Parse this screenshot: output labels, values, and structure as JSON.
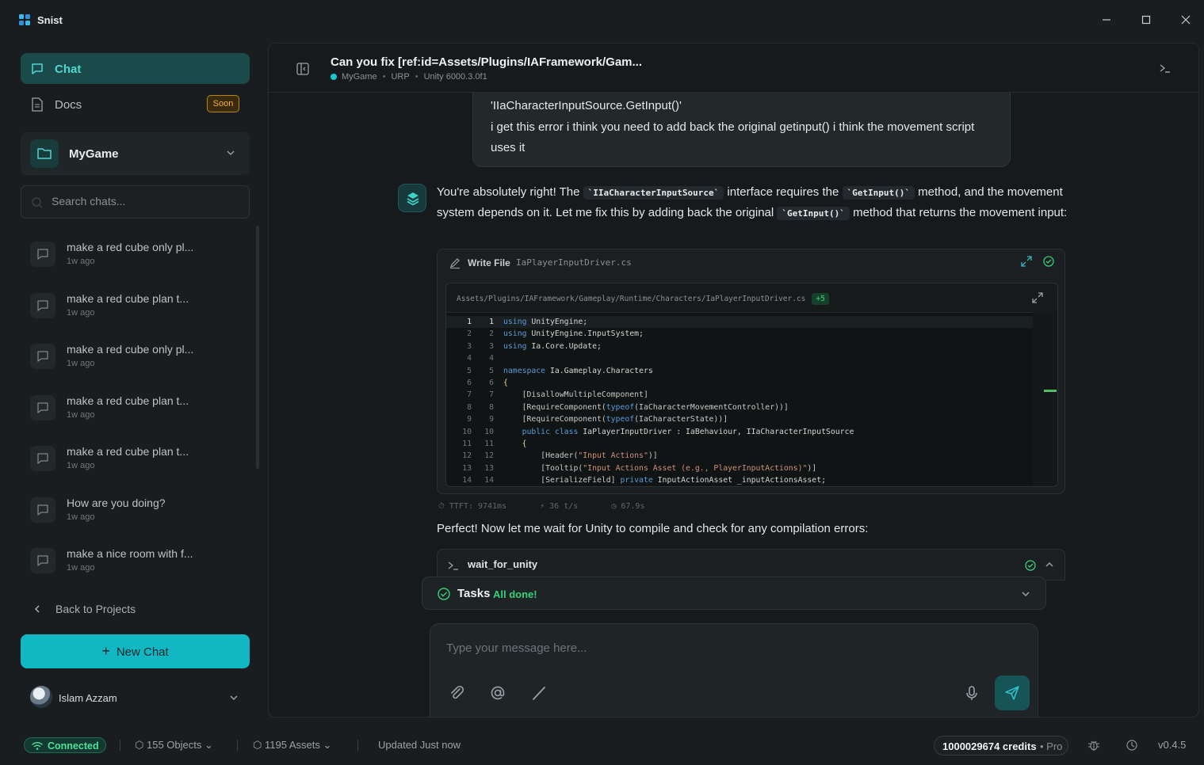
{
  "app": {
    "name": "Snist",
    "icons": {
      "logo": "grid-logo-icon",
      "minimize": "minimize-icon",
      "maximize": "maximize-icon",
      "close": "close-icon"
    }
  },
  "sidebar": {
    "nav": [
      {
        "label": "Chat",
        "icon": "chat-bubble-icon",
        "active": true
      },
      {
        "label": "Docs",
        "icon": "document-icon",
        "badge": "Soon"
      }
    ],
    "project": {
      "name": "MyGame",
      "icon": "folder-icon"
    },
    "search": {
      "placeholder": "Search chats..."
    },
    "chats": [
      {
        "title": "make a red cube only pl...",
        "time": "1w ago"
      },
      {
        "title": "make a red cube plan t...",
        "time": "1w ago"
      },
      {
        "title": "make a red cube only pl...",
        "time": "1w ago"
      },
      {
        "title": "make a red cube plan t...",
        "time": "1w ago"
      },
      {
        "title": "make a red cube plan t...",
        "time": "1w ago"
      },
      {
        "title": "How are you doing?",
        "time": "1w ago"
      },
      {
        "title": "make a nice room with f...",
        "time": "1w ago"
      }
    ],
    "back_label": "Back to Projects",
    "new_chat_label": "New Chat",
    "user": {
      "name": "Islam Azzam"
    }
  },
  "conversation": {
    "title": "Can you fix [ref:id=Assets/Plugins/IAFramework/Gam...",
    "meta": {
      "project": "MyGame",
      "pipeline": "URP",
      "engine": "Unity 6000.3.0f1"
    },
    "user_message": {
      "line1": "'IIaCharacterInputSource.GetInput()'",
      "line2": "i get this error i think you need to add back the original getinput() i think the movement script uses it"
    },
    "assistant": {
      "p1_a": "You're absolutely right! The",
      "code1": "`IIaCharacterInputSource`",
      "p1_b": "interface requires the",
      "code2": "`GetInput()`",
      "p1_c": "method, and the movement system depends on it. Let me fix this by adding back the original",
      "code3": "`GetInput()`",
      "p1_d": "method that returns the movement input:",
      "p2": "Perfect! Now let me wait for Unity to compile and check for any compilation errors:"
    },
    "write_file": {
      "label": "Write File",
      "filename": "IaPlayerInputDriver.cs",
      "path": "Assets/Plugins/IAFramework/Gameplay/Runtime/Characters/IaPlayerInputDriver.cs",
      "diff_badge": "+5",
      "lines": [
        {
          "n": "1",
          "html": "<span class=\"kw\">using</span> UnityEngine;"
        },
        {
          "n": "2",
          "html": "<span class=\"kw\">using</span> UnityEngine.InputSystem;"
        },
        {
          "n": "3",
          "html": "<span class=\"kw\">using</span> Ia.Core.Update;"
        },
        {
          "n": "4",
          "html": ""
        },
        {
          "n": "5",
          "html": "<span class=\"kw\">namespace</span> Ia.Gameplay.Characters"
        },
        {
          "n": "6",
          "html": "<span class=\"ty\">{</span>"
        },
        {
          "n": "7",
          "html": "    <span class=\"attr\">[DisallowMultipleComponent]</span>"
        },
        {
          "n": "8",
          "html": "    <span class=\"attr\">[RequireComponent(<span class=\"kw\">typeof</span>(IaCharacterMovementController))]</span>"
        },
        {
          "n": "9",
          "html": "    <span class=\"attr\">[RequireComponent(<span class=\"kw\">typeof</span>(IaCharacterState))]</span>"
        },
        {
          "n": "10",
          "html": "    <span class=\"kw\">public class</span> IaPlayerInputDriver : IaBehaviour, IIaCharacterInputSource"
        },
        {
          "n": "11",
          "html": "    <span class=\"ty\">{</span>"
        },
        {
          "n": "12",
          "html": "        <span class=\"attr\">[Header(<span class=\"str\">\"Input Actions\"</span>)]</span>"
        },
        {
          "n": "13",
          "html": "        <span class=\"attr\">[Tooltip(<span class=\"str\">\"Input Actions Asset (e.g., PlayerInputActions)\"</span>)]</span>"
        },
        {
          "n": "14",
          "html": "        <span class=\"attr\">[SerializeField]</span> <span class=\"kw\">private</span> InputActionAsset _inputActionsAsset;"
        }
      ]
    },
    "stats": {
      "ttft": "TTFT: 9741ms",
      "speed": "36 t/s",
      "duration": "67.9s"
    },
    "tool_call": {
      "name": "wait_for_unity"
    },
    "tasks": {
      "label": "Tasks",
      "status": "All done!"
    },
    "composer": {
      "placeholder": "Type your message here..."
    }
  },
  "statusbar": {
    "connection": "Connected",
    "objects": "155  Objects",
    "assets": "1195  Assets",
    "updated": "Updated Just now",
    "credits": "1000029674 credits",
    "plan": "• Pro",
    "version": "v0.4.5"
  },
  "colors": {
    "accent": "#11b8c4",
    "success": "#36d07a",
    "warning": "#f0b23a",
    "background": "#1a1d1f"
  }
}
